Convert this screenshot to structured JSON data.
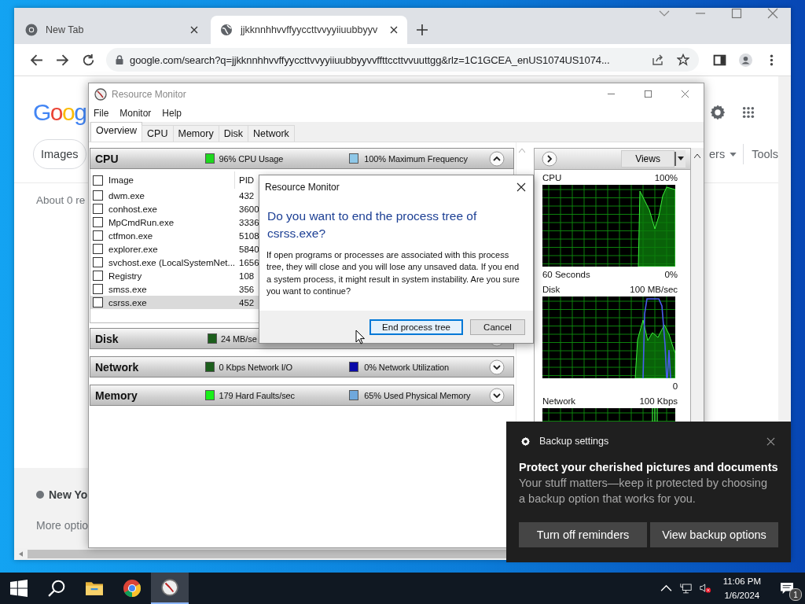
{
  "browser": {
    "tabs": [
      {
        "title": "New Tab",
        "selected": false,
        "kind": "chrome"
      },
      {
        "title": "jjkknnhhvvffyyccttvvyyiiuubbyyv",
        "selected": true,
        "kind": "globe"
      }
    ],
    "url": "google.com/search?q=jjkknnhhvvffyyccttvvyyiiuubbyyvvffttccttvvuuttgg&rlz=1C1GCEA_enUS1074US1074...",
    "page": {
      "logo": "Goog",
      "chips": [
        "Images"
      ],
      "filter": "ers",
      "tools": "Tools",
      "result_stats": "About 0 re",
      "location": "New Yo",
      "more_options": "More optio"
    }
  },
  "resource_monitor": {
    "title": "Resource Monitor",
    "menu": [
      "File",
      "Monitor",
      "Help"
    ],
    "tabs": [
      {
        "label": "Overview",
        "selected": true
      },
      {
        "label": "CPU",
        "selected": false
      },
      {
        "label": "Memory",
        "selected": false
      },
      {
        "label": "Disk",
        "selected": false
      },
      {
        "label": "Network",
        "selected": false
      }
    ],
    "sections": [
      {
        "name": "CPU",
        "expanded": true,
        "stats": [
          {
            "text": "96% CPU Usage",
            "color": "#1ed81e"
          },
          {
            "text": "100% Maximum Frequency",
            "color": "#8fc8e8"
          }
        ]
      },
      {
        "name": "Disk",
        "expanded": false,
        "stats": [
          {
            "text": "24 MB/se",
            "color": "#1c5e1c"
          }
        ]
      },
      {
        "name": "Network",
        "expanded": false,
        "stats": [
          {
            "text": "0 Kbps Network I/O",
            "color": "#1c5e1c"
          },
          {
            "text": "0% Network Utilization",
            "color": "#0a0aa8"
          }
        ]
      },
      {
        "name": "Memory",
        "expanded": false,
        "stats": [
          {
            "text": "179 Hard Faults/sec",
            "color": "#19f019"
          },
          {
            "text": "65% Used Physical Memory",
            "color": "#6fa8dc"
          }
        ]
      }
    ],
    "cpu_table": {
      "columns": [
        "Image",
        "PID"
      ],
      "all_checked": false,
      "rows": [
        {
          "image": "dwm.exe",
          "pid": "432",
          "checked": false,
          "selected": false
        },
        {
          "image": "conhost.exe",
          "pid": "3600",
          "checked": false,
          "selected": false
        },
        {
          "image": "MpCmdRun.exe",
          "pid": "3336",
          "checked": false,
          "selected": false
        },
        {
          "image": "ctfmon.exe",
          "pid": "5108",
          "checked": false,
          "selected": false
        },
        {
          "image": "explorer.exe",
          "pid": "5840",
          "checked": false,
          "selected": false
        },
        {
          "image": "svchost.exe (LocalSystemNet...",
          "pid": "1656",
          "checked": false,
          "selected": false
        },
        {
          "image": "Registry",
          "pid": "108",
          "checked": false,
          "selected": false
        },
        {
          "image": "smss.exe",
          "pid": "356",
          "checked": false,
          "selected": false
        },
        {
          "image": "csrss.exe",
          "pid": "452",
          "checked": false,
          "selected": true
        }
      ]
    },
    "graphs": {
      "views": "Views",
      "items": [
        {
          "kind": "cpu",
          "name": "CPU",
          "max": "100%",
          "time": "60 Seconds",
          "min": "0%"
        },
        {
          "kind": "disk",
          "name": "Disk",
          "max": "100 MB/sec",
          "min": "0"
        },
        {
          "kind": "network",
          "name": "Network",
          "max": "100 Kbps"
        }
      ]
    }
  },
  "dialog": {
    "title": "Resource Monitor",
    "heading": "Do you want to end the process tree of csrss.exe?",
    "message": "If open programs or processes are associated with this process tree, they will close and you will lose any unsaved data. If you end a system process, it might result in system instability. Are you sure you want to continue?",
    "buttons": [
      {
        "label": "End process tree",
        "focused": true
      },
      {
        "label": "Cancel",
        "focused": false
      }
    ]
  },
  "notification": {
    "app": "Backup settings",
    "title": "Protect your cherished pictures and documents",
    "message": "Your stuff matters—keep it protected by choosing a backup option that works for you.",
    "buttons": [
      "Turn off reminders",
      "View backup options"
    ]
  },
  "taskbar": {
    "apps": [
      {
        "kind": "windows",
        "selected": false
      },
      {
        "kind": "search",
        "selected": false
      },
      {
        "kind": "folder",
        "selected": false
      },
      {
        "kind": "chrome",
        "selected": false
      },
      {
        "kind": "gauge",
        "selected": true
      }
    ],
    "time": "11:06 PM",
    "date": "1/6/2024",
    "notification_count": "1"
  }
}
